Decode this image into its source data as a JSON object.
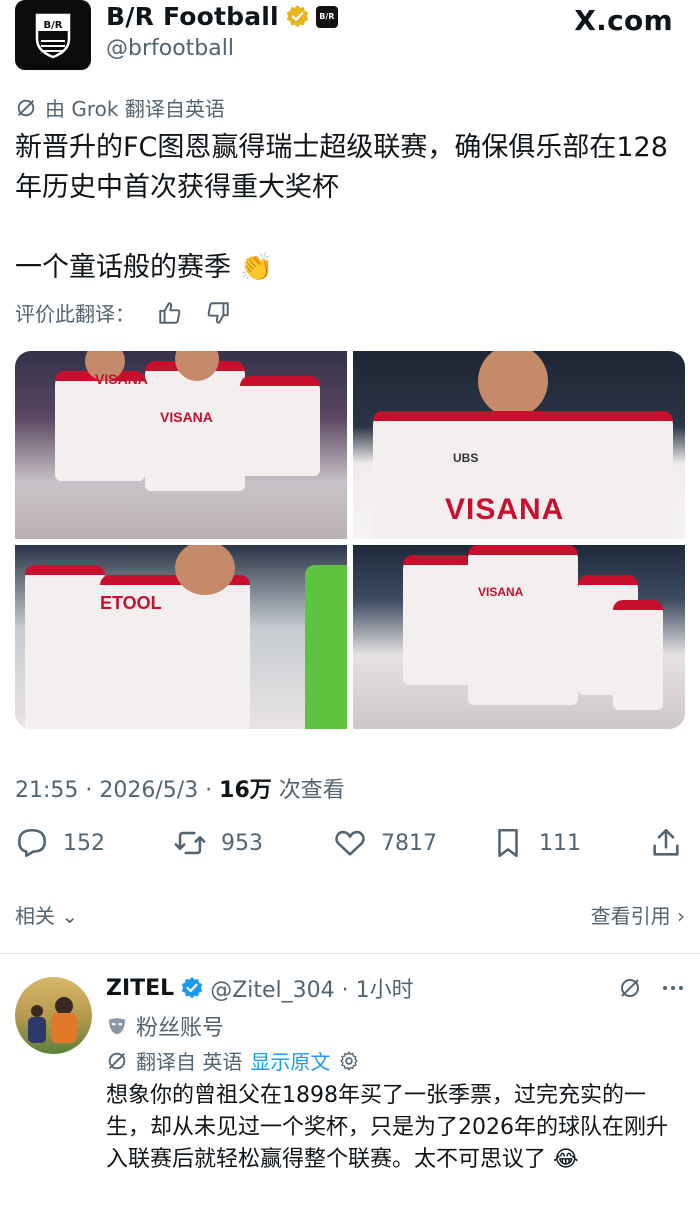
{
  "header": {
    "display_name": "B/R Football",
    "handle": "@brfootball",
    "site": "X.com",
    "logo_text": "B/R",
    "affiliate_badge": "B/R"
  },
  "translation": {
    "by_label": "由 Grok 翻译自英语",
    "rate_label": "评价此翻译："
  },
  "tweet": {
    "line1": "新晋升的FC图恩赢得瑞士超级联赛，确保俱乐部在128年历史中首次获得重大奖杯",
    "line2": "一个童话般的赛季 👏"
  },
  "media": {
    "sponsor_1": "VISANA",
    "sponsor_2": "UBS",
    "sponsor_3": "VISANA",
    "sponsor_4": "ETOOL",
    "sponsor_5": "VISANA"
  },
  "meta": {
    "time": "21:55 · 2026/5/3 · ",
    "views_count": "16万",
    "views_label": " 次查看"
  },
  "actions": {
    "replies": "152",
    "reposts": "953",
    "likes": "7817",
    "bookmarks": "111"
  },
  "related": {
    "left": "相关 ⌄",
    "right": "查看引用 ›"
  },
  "reply": {
    "name": "ZITEL",
    "handle_time": "@Zitel_304 · 1小时",
    "fan_label": "粉丝账号",
    "translated_from": "翻译自 英语",
    "show_original": "显示原文",
    "text": "想象你的曾祖父在1898年买了一张季票，过完充实的一生，却从未见过一个奖杯，只是为了2026年的球队在刚升入联赛后就轻松赢得整个联赛。太不可思议了 😂"
  },
  "colors": {
    "accent": "#1d9bf0",
    "muted": "#536471",
    "gold": "#e8b41c",
    "club_red": "#c8102e"
  }
}
